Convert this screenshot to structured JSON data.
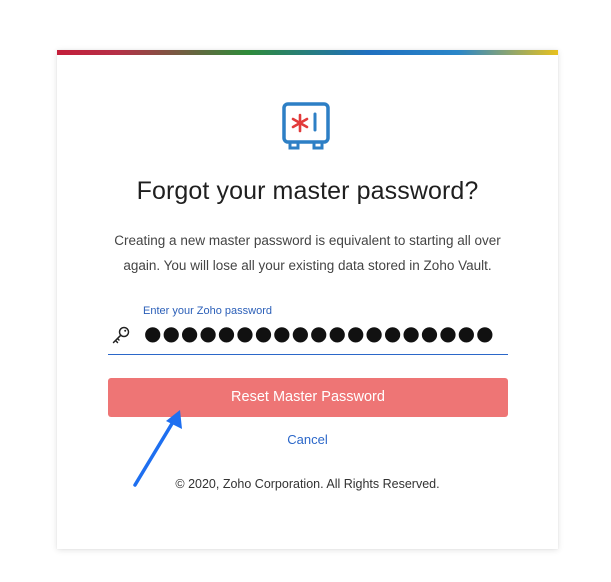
{
  "header": {
    "title": "Forgot your master password?"
  },
  "message": {
    "line1": "Creating a new master password is equivalent to starting all over",
    "line2": "again. You will lose all your existing data stored in Zoho Vault."
  },
  "password_field": {
    "label": "Enter your Zoho password",
    "masked_value": "●●●●●●●●●●●●●●●●●●●"
  },
  "actions": {
    "reset_label": "Reset Master Password",
    "cancel_label": "Cancel"
  },
  "footer": {
    "copyright": "© 2020, Zoho Corporation. All Rights Reserved."
  },
  "icons": {
    "logo": "vault-safe-icon",
    "key": "key-icon",
    "arrow": "annotation-arrow-icon"
  },
  "colors": {
    "button_bg": "#ee7575",
    "link": "#2b67c9",
    "logo_blue": "#2d7fc5",
    "logo_red": "#e23b3b",
    "arrow": "#1e6ff0"
  }
}
